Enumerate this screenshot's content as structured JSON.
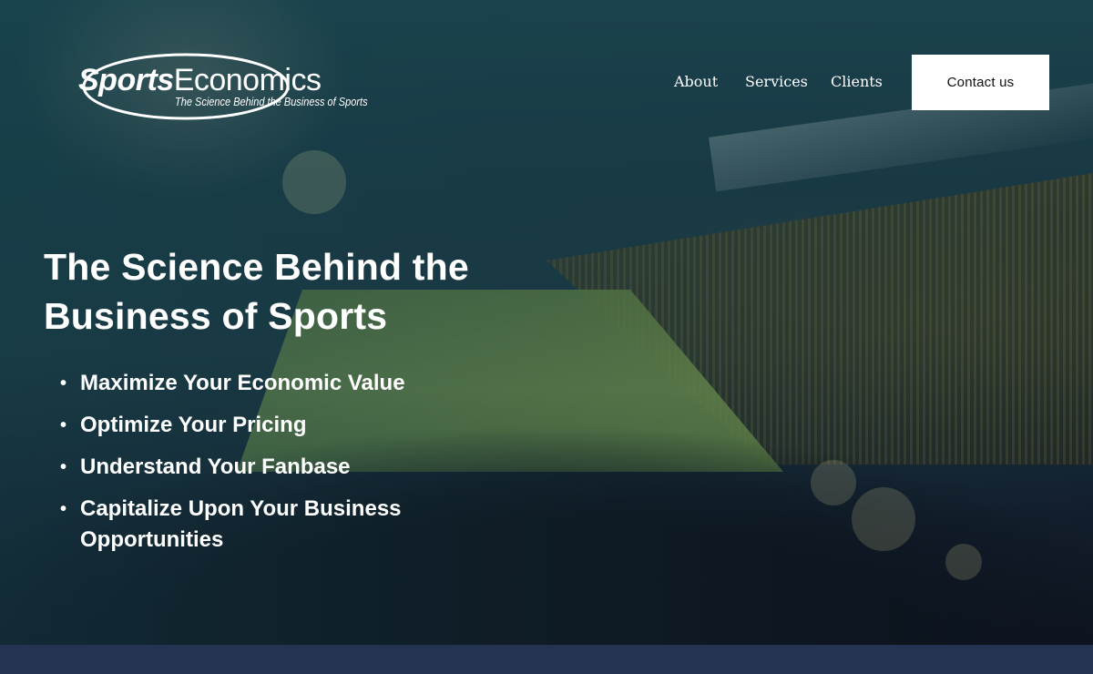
{
  "brand": {
    "name_part1": "Sports",
    "name_part2": "Economics",
    "tagline": "The Science Behind the Business of Sports"
  },
  "nav": {
    "items": [
      {
        "label": "About"
      },
      {
        "label": "Services"
      },
      {
        "label": "Clients"
      }
    ],
    "cta_label": "Contact us"
  },
  "hero": {
    "headline": "The Science Behind the Business of Sports",
    "bullets": [
      {
        "text": "Maximize Your Economic Value"
      },
      {
        "text": "Optimize Your Pricing"
      },
      {
        "text": "Understand Your Fanbase"
      },
      {
        "text": "Capitalize Upon Your Business Opportunities"
      }
    ]
  },
  "colors": {
    "hero_tint": "#1e4a55",
    "footer_band": "#243352",
    "cta_background": "#ffffff",
    "text": "#ffffff"
  }
}
